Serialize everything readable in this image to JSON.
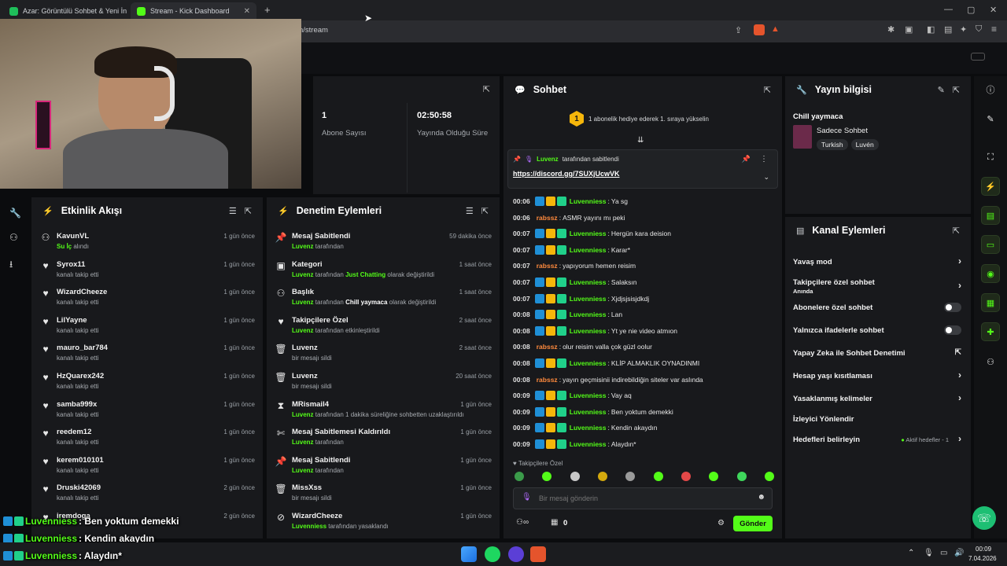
{
  "browser": {
    "tabs": [
      {
        "title": "Azar: Görüntülü Sohbet & Yeni İn",
        "active": false
      },
      {
        "title": "Stream - Kick Dashboard",
        "active": true
      }
    ],
    "url": "n/stream",
    "brand_color": "#53fc18"
  },
  "stats": {
    "subscribers_value": "1",
    "subscribers_label": "Abone Sayısı",
    "uptime_value": "02:50:58",
    "uptime_label": "Yayında Olduğu Süre"
  },
  "activity": {
    "title": "Etkinlik Akışı",
    "items": [
      {
        "name": "KavunVL",
        "desc_highlight": "Su İç",
        "desc": "alındı",
        "time": "1 gün önce",
        "icon": "gift-icon"
      },
      {
        "name": "Syrox11",
        "desc": "kanalı takip etti",
        "time": "1 gün önce",
        "icon": "heart-icon"
      },
      {
        "name": "WizardCheeze",
        "desc": "kanalı takip etti",
        "time": "1 gün önce",
        "icon": "heart-icon"
      },
      {
        "name": "LilYayne",
        "desc": "kanalı takip etti",
        "time": "1 gün önce",
        "icon": "heart-icon"
      },
      {
        "name": "mauro_bar784",
        "desc": "kanalı takip etti",
        "time": "1 gün önce",
        "icon": "heart-icon"
      },
      {
        "name": "HzQuarex242",
        "desc": "kanalı takip etti",
        "time": "1 gün önce",
        "icon": "heart-icon"
      },
      {
        "name": "samba999x",
        "desc": "kanalı takip etti",
        "time": "1 gün önce",
        "icon": "heart-icon"
      },
      {
        "name": "reedem12",
        "desc": "kanalı takip etti",
        "time": "1 gün önce",
        "icon": "heart-icon"
      },
      {
        "name": "kerem010101",
        "desc": "kanalı takip etti",
        "time": "1 gün önce",
        "icon": "heart-icon"
      },
      {
        "name": "Druski42069",
        "desc": "kanalı takip etti",
        "time": "2 gün önce",
        "icon": "heart-icon"
      },
      {
        "name": "iremdoga",
        "desc": "",
        "time": "2 gün önce",
        "icon": "heart-icon"
      }
    ]
  },
  "moderation": {
    "title": "Denetim Eylemleri",
    "items": [
      {
        "title": "Mesaj Sabitlendi",
        "by": "Luvenz",
        "desc": "tarafından",
        "time": "59 dakika önce",
        "icon": "pin-icon"
      },
      {
        "title": "Kategori",
        "by": "Luvenz",
        "desc": "tarafından",
        "highlight": "Just Chatting",
        "desc2": "olarak değiştirildi",
        "time": "1 saat önce",
        "icon": "category-icon"
      },
      {
        "title": "Başlık",
        "by": "Luvenz",
        "desc": "tarafından",
        "highlight_w": "Chill yaymaca",
        "desc2": "olarak değiştirildi",
        "time": "1 saat önce",
        "icon": "user-edit-icon"
      },
      {
        "title": "Takipçilere Özel",
        "by": "Luvenz",
        "desc": "tarafından etkinleştirildi",
        "time": "2 saat önce",
        "icon": "heart-icon"
      },
      {
        "title": "Luvenz",
        "desc": "bir mesajı sildi",
        "time": "2 saat önce",
        "icon": "trash-icon"
      },
      {
        "title": "Luvenz",
        "desc": "bir mesajı sildi",
        "time": "20 saat önce",
        "icon": "trash-icon"
      },
      {
        "title": "MRismail4",
        "by": "Luvenz",
        "desc": "tarafından 1 dakika süreliğine sohbetten uzaklaştırıldı",
        "time": "1 gün önce",
        "icon": "hourglass-icon"
      },
      {
        "title": "Mesaj Sabitlemesi Kaldırıldı",
        "by": "Luvenz",
        "desc": "tarafından",
        "time": "1 gün önce",
        "icon": "unpin-icon"
      },
      {
        "title": "Mesaj Sabitlendi",
        "by": "Luvenz",
        "desc": "tarafından",
        "time": "1 gün önce",
        "icon": "pin-icon"
      },
      {
        "title": "MissXss",
        "desc": "bir mesajı sildi",
        "time": "1 gün önce",
        "icon": "trash-icon"
      },
      {
        "title": "WizardCheeze",
        "by": "Luvenniess",
        "desc": "tarafından yasaklandı",
        "time": "1 gün önce",
        "icon": "ban-icon"
      }
    ]
  },
  "chat": {
    "title": "Sohbet",
    "gift_banner": "1 abonelik hediye ederek 1. sıraya yükselin",
    "gift_rank": "1",
    "pinned_by": "Luvenz",
    "pinned_by_suffix": "tarafından sabitlendi",
    "pinned_link": "https://discord.gg/7SUXjUcwVK",
    "messages": [
      {
        "time": "00:06",
        "user": "Luvenniess",
        "badges": true,
        "text": "Ya sg"
      },
      {
        "time": "00:06",
        "user": "rabssz",
        "badges": false,
        "text": "ASMR yayını mı peki"
      },
      {
        "time": "00:07",
        "user": "Luvenniess",
        "badges": true,
        "text": "Hergün kara deision"
      },
      {
        "time": "00:07",
        "user": "Luvenniess",
        "badges": true,
        "text": "Karar*"
      },
      {
        "time": "00:07",
        "user": "rabssz",
        "badges": false,
        "text": "yapıyorum hemen reisim"
      },
      {
        "time": "00:07",
        "user": "Luvenniess",
        "badges": true,
        "text": "Salaksın"
      },
      {
        "time": "00:07",
        "user": "Luvenniess",
        "badges": true,
        "text": "Xjdjsjsisjdkdj"
      },
      {
        "time": "00:08",
        "user": "Luvenniess",
        "badges": true,
        "text": "Lan"
      },
      {
        "time": "00:08",
        "user": "Luvenniess",
        "badges": true,
        "text": "Yt ye nie video atmıon"
      },
      {
        "time": "00:08",
        "user": "rabssz",
        "badges": false,
        "text": "olur reisim valla çok güzl oolur"
      },
      {
        "time": "00:08",
        "user": "Luvenniess",
        "badges": true,
        "text": "KLİP ALMAKLIK OYNADINMI"
      },
      {
        "time": "00:08",
        "user": "rabssz",
        "badges": false,
        "text": "yayın geçmisinii indirebildiğin siteler var aslında"
      },
      {
        "time": "00:09",
        "user": "Luvenniess",
        "badges": true,
        "text": "Vay aq"
      },
      {
        "time": "00:09",
        "user": "Luvenniess",
        "badges": true,
        "text": "Ben yoktum demekki"
      },
      {
        "time": "00:09",
        "user": "Luvenniess",
        "badges": true,
        "text": "Kendin akaydın"
      },
      {
        "time": "00:09",
        "user": "Luvenniess",
        "badges": true,
        "text": "Alaydın*"
      }
    ],
    "mode_label": "Takipçilere Özel",
    "input_placeholder": "Bir mesaj gönderin",
    "points": "0",
    "send_label": "Gönder"
  },
  "stream_info": {
    "title": "Yayın bilgisi",
    "stream_title": "Chill yaymaca",
    "category": "Sadece Sohbet",
    "tags": [
      "Turkish",
      "Luvén"
    ]
  },
  "channel_actions": {
    "title": "Kanal Eylemleri",
    "rows": [
      {
        "label": "Yavaş mod",
        "type": "chevron"
      },
      {
        "label": "Takipçilere özel sohbet",
        "sub": "Anında",
        "type": "chevron"
      },
      {
        "label": "Abonelere özel sohbet",
        "type": "toggle"
      },
      {
        "label": "Yalnızca ifadelerle sohbet",
        "type": "toggle"
      },
      {
        "label": "Yapay Zeka ile Sohbet Denetimi",
        "type": "external"
      },
      {
        "label": "Hesap yaşı kısıtlaması",
        "type": "chevron"
      },
      {
        "label": "Yasaklanmış kelimeler",
        "type": "chevron"
      },
      {
        "label": "İzleyici Yönlendir",
        "type": "none"
      },
      {
        "label": "Hedefleri belirleyin",
        "status": "Aktif hedefler - 1",
        "type": "chevron"
      }
    ]
  },
  "overlay": {
    "lines": [
      {
        "user": "Luvenniess",
        "text": ": Ben yoktum demekki"
      },
      {
        "user": "Luvenniess",
        "text": ": Kendin akaydın"
      },
      {
        "user": "Luvenniess",
        "text": ": Alaydın*"
      }
    ]
  },
  "taskbar": {
    "time": "00:09",
    "date": "7.04.2026"
  }
}
